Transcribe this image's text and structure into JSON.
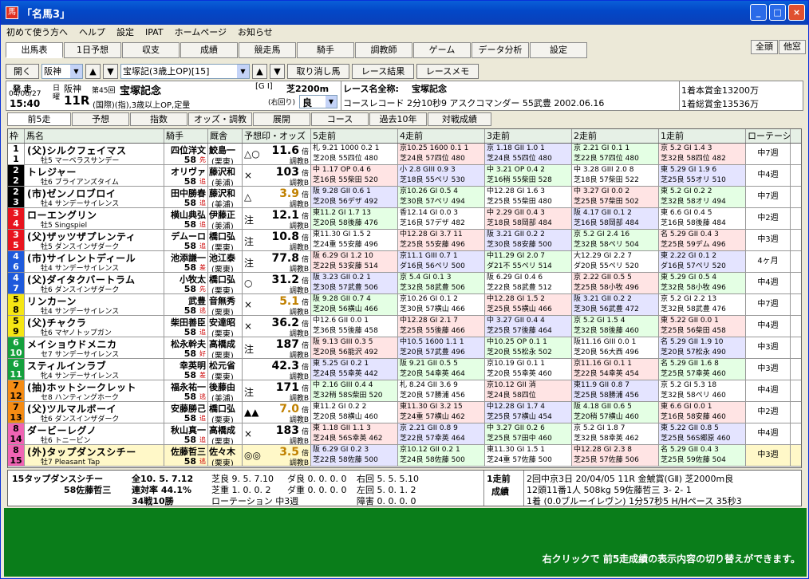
{
  "window": {
    "title": "「名馬3」"
  },
  "menu": [
    "初めて使う方へ",
    "ヘルプ",
    "設定",
    "IPAT",
    "ホームページ",
    "お知らせ"
  ],
  "tabs1": [
    {
      "label": "出馬表",
      "selected": true
    },
    {
      "label": "1日予想"
    },
    {
      "label": "収支"
    },
    {
      "label": "成績"
    },
    {
      "label": "競走馬"
    },
    {
      "label": "騎手"
    },
    {
      "label": "調教師"
    },
    {
      "label": "ゲーム"
    },
    {
      "label": "データ分析"
    },
    {
      "label": "設定"
    }
  ],
  "topright": [
    "全頭",
    "他窓"
  ],
  "toolbar": {
    "open": "開く",
    "course": "阪神",
    "race": "宝塚記(3歳上OP)[15]",
    "cancel": "取り消し馬",
    "result": "レース結果",
    "memo": "レースメモ"
  },
  "race_info": {
    "hasso": "発 走",
    "date": "04/06/27",
    "time": "15:40",
    "day_label": "日曜",
    "venue": "阪神",
    "race_no": "11R",
    "kai": "第45回",
    "race_name": "宝塚記念",
    "cond": "(国際)(指),3歳以上OP,定量",
    "grade": "[G I]",
    "dist": "芝2200m",
    "turn": "(右回り)",
    "going": "良",
    "full_label": "レース名全称:",
    "full_name": "宝塚記念",
    "record": "コースレコード 2分10秒9 アスクコマンダー 55武豊 2002.06.16",
    "prize1": "1着本賞金13200万",
    "prize2": "1着総賞金13536万"
  },
  "tabs2": [
    "前5走",
    "予想",
    "指数",
    "オッズ・調教",
    "展開",
    "コース",
    "過去10年",
    "対戦成績"
  ],
  "headers": [
    "枠",
    "馬名",
    "騎手",
    "厩舎",
    "予想印・オッズ",
    "5走前",
    "4走前",
    "3走前",
    "2走前",
    "1走前",
    "ローテーション"
  ],
  "horses": [
    {
      "waku": "1",
      "umaban": "1",
      "name": "(父)シルクフェイマス",
      "sub": "牡5 マーベラスサンデー",
      "jockey": "四位洋文",
      "weight": "58",
      "tag": "先",
      "trainer": "鮫島一",
      "stable": "(栗東)",
      "mark": "△○",
      "odds": "11.6",
      "unit": "倍",
      "chokyo": "調教B",
      "p5": [
        "札 9.21 1000 0.2 1",
        "芝20良 55四位 480"
      ],
      "p4": [
        "京10.25 1600 0.1 1",
        "芝24良 57四位 480"
      ],
      "p3": [
        "京 1.18 GII 1.0 1",
        "芝24良 55四位 480"
      ],
      "p2": [
        "京 2.21 GI 0.1 1",
        "芝22良 57四位 480"
      ],
      "p1": [
        "京 5.2 GI 1.4 3",
        "芝32良 58四位 482"
      ],
      "rot": "中7週"
    },
    {
      "waku": "2",
      "umaban": "2",
      "name": "トレジャー",
      "sub": "牡6 ブライアンズタイム",
      "jockey": "オリヴァ",
      "weight": "58",
      "tag": "追",
      "trainer": "藤沢和",
      "stable": "(美浦)",
      "mark": "×",
      "odds": "103",
      "unit": "倍",
      "chokyo": "調教B",
      "p5": [
        "中 1.17 OP 0.4 6",
        "芝16良 55柴田 520"
      ],
      "p4": [
        "小 2.8 GIII 0.9 3",
        "芝18良 55ペリ 530"
      ],
      "p3": [
        "中 3.21 OP 0.4 2",
        "芝16稍 55柴田 528"
      ],
      "p2": [
        "中 3.28 GIII 2.0 8",
        "芝18良 57柴田 522"
      ],
      "p1": [
        "東 5.29 GI 1.9 6",
        "芝25良 55オリ 510"
      ],
      "rot": "中4週"
    },
    {
      "waku": "2",
      "umaban": "3",
      "name": "(市)ゼンノロブロイ",
      "sub": "牡4 サンデーサイレンス",
      "jockey": "田中勝春",
      "weight": "58",
      "tag": "追",
      "trainer": "藤沢和",
      "stable": "(美浦)",
      "mark": "△",
      "odds": "3.9",
      "unit": "倍",
      "chokyo": "調教B",
      "p5": [
        "阪 9.28 GII 0.6 1",
        "芝20良 56デザ 492"
      ],
      "p4": [
        "京10.26 GI 0.5 4",
        "芝30良 57ペリ 494"
      ],
      "p3": [
        "中12.28 GI 1.6 3",
        "芝25良 55柴田 480"
      ],
      "p2": [
        "中 3.27 GI 0.0 2",
        "芝25良 57柴田 502"
      ],
      "p1": [
        "東 5.2 GI 0.2 2",
        "芝32良 58オリ 494"
      ],
      "rot": "中7週"
    },
    {
      "waku": "3",
      "umaban": "4",
      "name": "ローエングリン",
      "sub": "牡5 Singspiel",
      "jockey": "横山典弘",
      "weight": "58",
      "tag": "追",
      "trainer": "伊藤正",
      "stable": "(美浦)",
      "mark": "注",
      "odds": "12.1",
      "unit": "倍",
      "chokyo": "調教B",
      "p5": [
        "東11.2 GI 1.7 13",
        "芝20良 58後藤 476"
      ],
      "p4": [
        "香12.14 GI 0.0 3",
        "芝16良 57デザ 482"
      ],
      "p3": [
        "中 2.29 GII 0.4 3",
        "芝18良 58岡部 484"
      ],
      "p2": [
        "阪 4.17 GII 0.1 2",
        "芝16良 58岡部 484"
      ],
      "p1": [
        "東 6.6 GI 0.4 5",
        "芝16良 58後藤 484"
      ],
      "rot": "中2週"
    },
    {
      "waku": "3",
      "umaban": "5",
      "name": "(父)ザッツザプレンティ",
      "sub": "牡5 ダンスインザダーク",
      "jockey": "デムーロ",
      "weight": "58",
      "tag": "追",
      "trainer": "橋口弘",
      "stable": "(栗東)",
      "mark": "注",
      "odds": "10.8",
      "unit": "倍",
      "chokyo": "調教B",
      "p5": [
        "東11.30 GI 1.5 2",
        "芝24重 55安藤 496"
      ],
      "p4": [
        "中12.28 GI 3.7 11",
        "芝25良 55安藤 496"
      ],
      "p3": [
        "阪 3.21 GII 0.2 2",
        "芝30良 58安藤 500"
      ],
      "p2": [
        "京 5.2 GI 2.4 16",
        "芝32良 58ペリ 504"
      ],
      "p1": [
        "名 5.29 GII 0.4 3",
        "芝25良 59デム 496"
      ],
      "rot": "中3週"
    },
    {
      "waku": "4",
      "umaban": "6",
      "name": "(市)サイレントディール",
      "sub": "牡4 サンデーサイレンス",
      "jockey": "池添謙一",
      "weight": "58",
      "tag": "差",
      "trainer": "池江泰",
      "stable": "(栗東)",
      "mark": "注",
      "odds": "77.8",
      "unit": "倍",
      "chokyo": "調教B",
      "p5": [
        "阪 6.29 GI 1.2 10",
        "芝22良 53安藤 514"
      ],
      "p4": [
        "京11.1 GIII 0.7 1",
        "ダ16良 56ペリ 500"
      ],
      "p3": [
        "中11.29 GI 2.0 7",
        "ダ21不 55ペリ 514"
      ],
      "p2": [
        "大12.29 GI 2.2 7",
        "ダ20良 55ペリ 520"
      ],
      "p1": [
        "東 2.22 GI 0.1 2",
        "ダ16良 57ペリ 520"
      ],
      "rot": "4ヶ月"
    },
    {
      "waku": "4",
      "umaban": "7",
      "name": "(父)ダイタクバートラム",
      "sub": "牡6 ダンスインザダーク",
      "jockey": "小牧太",
      "weight": "58",
      "tag": "先",
      "trainer": "橋口弘",
      "stable": "(栗東)",
      "mark": "○",
      "odds": "31.2",
      "unit": "倍",
      "chokyo": "調教B",
      "p5": [
        "阪 3.23 GII 0.2 1",
        "芝30良 57武豊 506"
      ],
      "p4": [
        "京 5.4 GI 0.1 3",
        "芝32良 58武豊 506"
      ],
      "p3": [
        "阪 6.29 GI 0.4 6",
        "芝22良 58武豊 512"
      ],
      "p2": [
        "京 2.22 GII 0.5 5",
        "芝25良 58小牧 496"
      ],
      "p1": [
        "東 5.29 GI 0.5 4",
        "芝32良 58小牧 496"
      ],
      "rot": "中4週"
    },
    {
      "waku": "5",
      "umaban": "8",
      "name": "リンカーン",
      "sub": "牡4 サンデーサイレンス",
      "jockey": "武豊",
      "weight": "58",
      "tag": "逃",
      "trainer": "音無秀",
      "stable": "(栗東)",
      "mark": "×",
      "odds": "5.1",
      "unit": "倍",
      "chokyo": "調教B",
      "p5": [
        "阪 9.28 GII 0.7 4",
        "芝20良 56横山 466"
      ],
      "p4": [
        "京10.26 GI 0.1 2",
        "芝30良 57横山 466"
      ],
      "p3": [
        "中12.28 GI 1.5 2",
        "芝25良 55横山 466"
      ],
      "p2": [
        "阪 3.21 GII 0.2 2",
        "芝30良 56武豊 472"
      ],
      "p1": [
        "京 5.2 GI 2.2 13",
        "芝32良 58武豊 476"
      ],
      "rot": "中7週"
    },
    {
      "waku": "5",
      "umaban": "9",
      "name": "(父)チャクラ",
      "sub": "牡6 マヤノトップガン",
      "jockey": "柴田善臣",
      "weight": "58",
      "tag": "追",
      "trainer": "安達昭",
      "stable": "(栗東)",
      "mark": "×",
      "odds": "36.2",
      "unit": "倍",
      "chokyo": "調教B",
      "p5": [
        "中12.6 GII 0.0 1",
        "芝36良 55後藤 458"
      ],
      "p4": [
        "中12.28 GI 2.1 7",
        "芝25良 55後藤 466"
      ],
      "p3": [
        "中 3.27 GII 0.4 4",
        "芝25良 57後藤 464"
      ],
      "p2": [
        "京 5.2 GI 1.5 4",
        "芝32良 58後藤 460"
      ],
      "p1": [
        "東 5.22 GII 0.0 1",
        "芝25良 56柴田 458"
      ],
      "rot": "中4週"
    },
    {
      "waku": "6",
      "umaban": "10",
      "name": "メイショウドメニカ",
      "sub": "セ7 サンデーサイレンス",
      "jockey": "松永幹夫",
      "weight": "58",
      "tag": "好",
      "trainer": "高橋成",
      "stable": "(栗東)",
      "mark": "注",
      "odds": "187",
      "unit": "倍",
      "chokyo": "調教B",
      "p5": [
        "阪 9.13 GIII 0.3 5",
        "芝20良 56能沢 492"
      ],
      "p4": [
        "中10.5 1600 1.1 1",
        "芝20良 57武豊 496"
      ],
      "p3": [
        "中10.25 OP 0.1 1",
        "芝20良 55松永 502"
      ],
      "p2": [
        "阪11.16 GIII 0.0 1",
        "芝20良 56大西 496"
      ],
      "p1": [
        "名 5.29 GII 1.9 10",
        "芝20良 57松永 490"
      ],
      "rot": "中3週"
    },
    {
      "waku": "6",
      "umaban": "11",
      "name": "スティルインラブ",
      "sub": "牝4 サンデーサイレンス",
      "jockey": "幸英明",
      "weight": "58",
      "tag": "差",
      "trainer": "松元省",
      "stable": "(栗東)",
      "mark": "",
      "odds": "42.3",
      "unit": "倍",
      "chokyo": "調教B",
      "p5": [
        "東 5.25 GI 0.2 1",
        "芝24良 55幸英 442"
      ],
      "p4": [
        "阪 9.21 GII 0.5 5",
        "芝20良 54幸英 464"
      ],
      "p3": [
        "京10.19 GI 0.1 1",
        "芝20良 55幸英 460"
      ],
      "p2": [
        "京11.16 GI 0.1 1",
        "芝22良 54幸英 454"
      ],
      "p1": [
        "名 5.29 GII 1.6 8",
        "芝25良 57幸英 460"
      ],
      "rot": "中3週"
    },
    {
      "waku": "7",
      "umaban": "12",
      "name": "(抽)ホットシークレット",
      "sub": "セ8 ハンティングホーク",
      "jockey": "福永祐一",
      "weight": "58",
      "tag": "逃",
      "trainer": "後藤由",
      "stable": "(美浦)",
      "mark": "注",
      "odds": "171",
      "unit": "倍",
      "chokyo": "調教B",
      "p5": [
        "中 2.16 GIII 0.4 4",
        "芝32稍 58S柴田 520"
      ],
      "p4": [
        "札 8.24 GII 3.6 9",
        "芝20良 57勝浦 456"
      ],
      "p3": [
        "京10.12 GII 消",
        "芝24良 58四位 "
      ],
      "p2": [
        "東11.9 GII 0.8 7",
        "芝25良 58勝浦 456"
      ],
      "p1": [
        "京 5.2 GI 5.3 18",
        "芝32良 58ペリ 460"
      ],
      "rot": "中4週"
    },
    {
      "waku": "7",
      "umaban": "13",
      "name": "(父)ツルマルボーイ",
      "sub": "牡6 ダンスインザダーク",
      "jockey": "安藤勝己",
      "weight": "58",
      "tag": "追",
      "trainer": "橋口弘",
      "stable": "(栗東)",
      "mark": "▲▲",
      "odds": "7.0",
      "unit": "倍",
      "chokyo": "調教B",
      "p5": [
        "東11.2 GI 0.2 2",
        "芝20良 58横山 460"
      ],
      "p4": [
        "東11.30 GI 3.2 15",
        "芝24重 57横山 462"
      ],
      "p3": [
        "中12.28 GI 1.7 4",
        "芝25良 57横山 454"
      ],
      "p2": [
        "阪 4.18 GII 0.6 5",
        "芝20稍 57横山 460"
      ],
      "p1": [
        "東 6.6 GI 0.0 1",
        "芝16良 58安藤 460"
      ],
      "rot": "中2週"
    },
    {
      "waku": "8",
      "umaban": "14",
      "name": "ダービーレグノ",
      "sub": "牡6 トニービン",
      "jockey": "秋山真一",
      "weight": "58",
      "tag": "追",
      "trainer": "高橋成",
      "stable": "(栗東)",
      "mark": "×",
      "odds": "183",
      "unit": "倍",
      "chokyo": "調教B",
      "p5": [
        "東 1.18 GII 1.1 3",
        "芝24良 56S幸英 462"
      ],
      "p4": [
        "京 2.21 GII 0.8 9",
        "芝22良 57幸英 464"
      ],
      "p3": [
        "中 3.27 GII 0.2 6",
        "芝25良 57田中 460"
      ],
      "p2": [
        "京 5.2 GI 1.8 7",
        "芝32良 58幸英 462"
      ],
      "p1": [
        "東 5.22 GII 0.8 5",
        "芝25良 56S郷原 460"
      ],
      "rot": "中4週"
    },
    {
      "waku": "8",
      "umaban": "15",
      "name": "(外)タップダンスシチー",
      "sub": "牡7 Pleasant Tap",
      "jockey": "佐藤哲三",
      "weight": "58",
      "tag": "逃",
      "trainer": "佐々木",
      "stable": "(栗東)",
      "mark": "◎◎",
      "odds": "3.5",
      "unit": "倍",
      "chokyo": "調教B",
      "p5": [
        "阪 6.29 GI 0.2 3",
        "芝22良 58佐藤 500"
      ],
      "p4": [
        "京10.12 GII 0.2 1",
        "芝24良 58佐藤 500"
      ],
      "p3": [
        "東11.30 GI 1.5 1",
        "芝24重 57佐藤 500"
      ],
      "p2": [
        "中12.28 GI 2.3 8",
        "芝25良 57佐藤 506"
      ],
      "p1": [
        "名 5.29 GII 0.4 3",
        "芝25良 59佐藤 504"
      ],
      "rot": "中3週"
    }
  ],
  "bottom": {
    "horse": "15タップダンスシチー",
    "jockey": "58佐藤哲三",
    "l1a": "全10. 5. 7.12",
    "l2a": "連対率 44.1%",
    "l3a": "34戦10勝",
    "l1b": "芝良 9. 5. 7.10",
    "l2b": "芝重 1. 0. 0. 2",
    "l3b": "ローテーション 中3週",
    "l1c": "ダ良 0. 0. 0. 0",
    "l2c": "ダ重 0. 0. 0. 0",
    "l1d": "右回 5. 5. 5.10",
    "l2d": "左回 5. 0. 1. 2",
    "l3d": "障害 0. 0. 0. 0",
    "r_label1": "1走前",
    "r_label2": "成績",
    "r1": "2回中京3日 20/04/05 11R 金鯱賞(GⅡ) 芝2000m良",
    "r2": "12頭11番1人 508kg 59佐藤哲三 3- 2- 1",
    "r3": "1着 (0.0ブルーイレヴン) 1分57秒5 H/Hペース 35秒3"
  },
  "footer_msg": "右クリックで 前5走成績の表示内容の切り替えができます。",
  "colors": {
    "waku1": "#ffffff",
    "waku2": "#000000",
    "waku3": "#e8141e",
    "waku4": "#1e5adc",
    "waku5": "#f5e614",
    "waku6": "#14a03c",
    "waku7": "#f58c14",
    "waku8": "#f064b4"
  }
}
